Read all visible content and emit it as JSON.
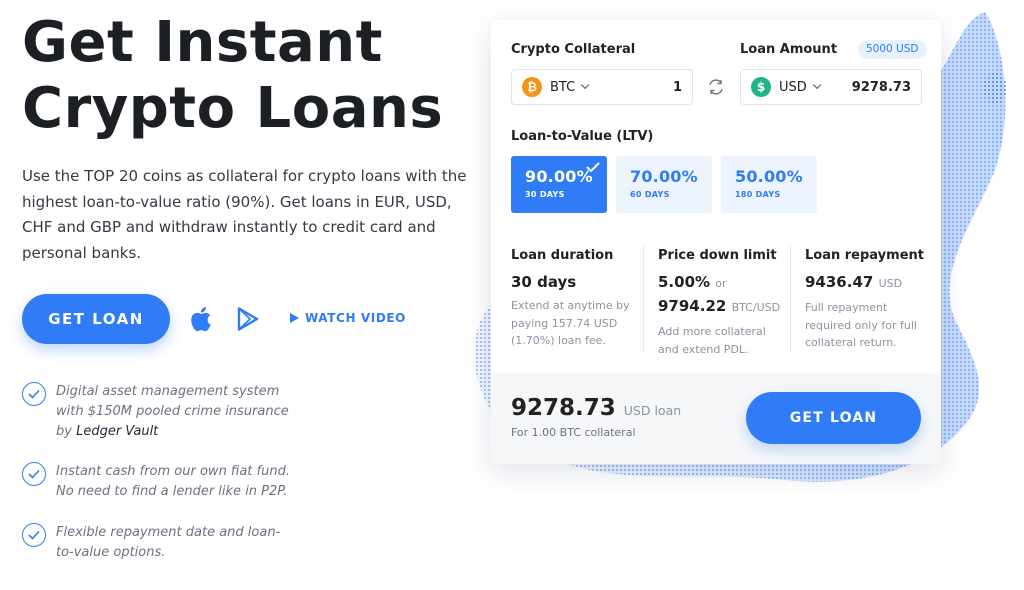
{
  "hero": {
    "title": "Get Instant Crypto Loans",
    "description": "Use the TOP 20 coins as collateral for crypto loans with the highest loan-to-value ratio (90%). Get loans in EUR, USD, CHF and GBP and withdraw instantly to credit card and personal banks.",
    "get_loan_label": "GET LOAN",
    "watch_video_label": "WATCH VIDEO",
    "apple_icon": "apple-icon",
    "play_store_icon": "google-play-icon"
  },
  "features": [
    {
      "text": "Digital asset management system with $150M pooled crime insurance by ",
      "strong": "Ledger Vault"
    },
    {
      "text": "Instant cash from our own fiat fund. No need to find a lender like in P2P.",
      "strong": ""
    },
    {
      "text": "Flexible repayment date and loan-to-value options.",
      "strong": ""
    }
  ],
  "card": {
    "collateral_label": "Crypto Collateral",
    "loan_amount_label": "Loan Amount",
    "loan_badge": "5000 USD",
    "collateral": {
      "currency": "BTC",
      "amount": "1",
      "icon": "bitcoin-icon"
    },
    "loan": {
      "currency": "USD",
      "amount": "9278.73",
      "icon": "dollar-icon"
    },
    "ltv_label": "Loan-to-Value (LTV)",
    "ltv_options": [
      {
        "pct": "90.00%",
        "days": "30 DAYS",
        "selected": true
      },
      {
        "pct": "70.00%",
        "days": "60 DAYS",
        "selected": false
      },
      {
        "pct": "50.00%",
        "days": "180 DAYS",
        "selected": false
      }
    ],
    "duration": {
      "header": "Loan duration",
      "value": "30 days",
      "desc": "Extend at anytime by paying 157.74 USD (1.70%) loan fee."
    },
    "price_down": {
      "header": "Price down limit",
      "value1": "5.00%",
      "or": "or",
      "value2": "9794.22",
      "unit": "BTC/USD",
      "desc": "Add more collateral and extend PDL."
    },
    "repayment": {
      "header": "Loan repayment",
      "value": "9436.47",
      "unit": "USD",
      "desc": "Full repayment required only for full collateral return."
    },
    "summary": {
      "amount": "9278.73",
      "unit": "USD loan",
      "collateral_note": "For 1.00 BTC collateral",
      "button": "GET LOAN"
    }
  },
  "colors": {
    "accent": "#2f7cf6",
    "bitcoin": "#f7931a",
    "usd": "#1fb58a"
  }
}
